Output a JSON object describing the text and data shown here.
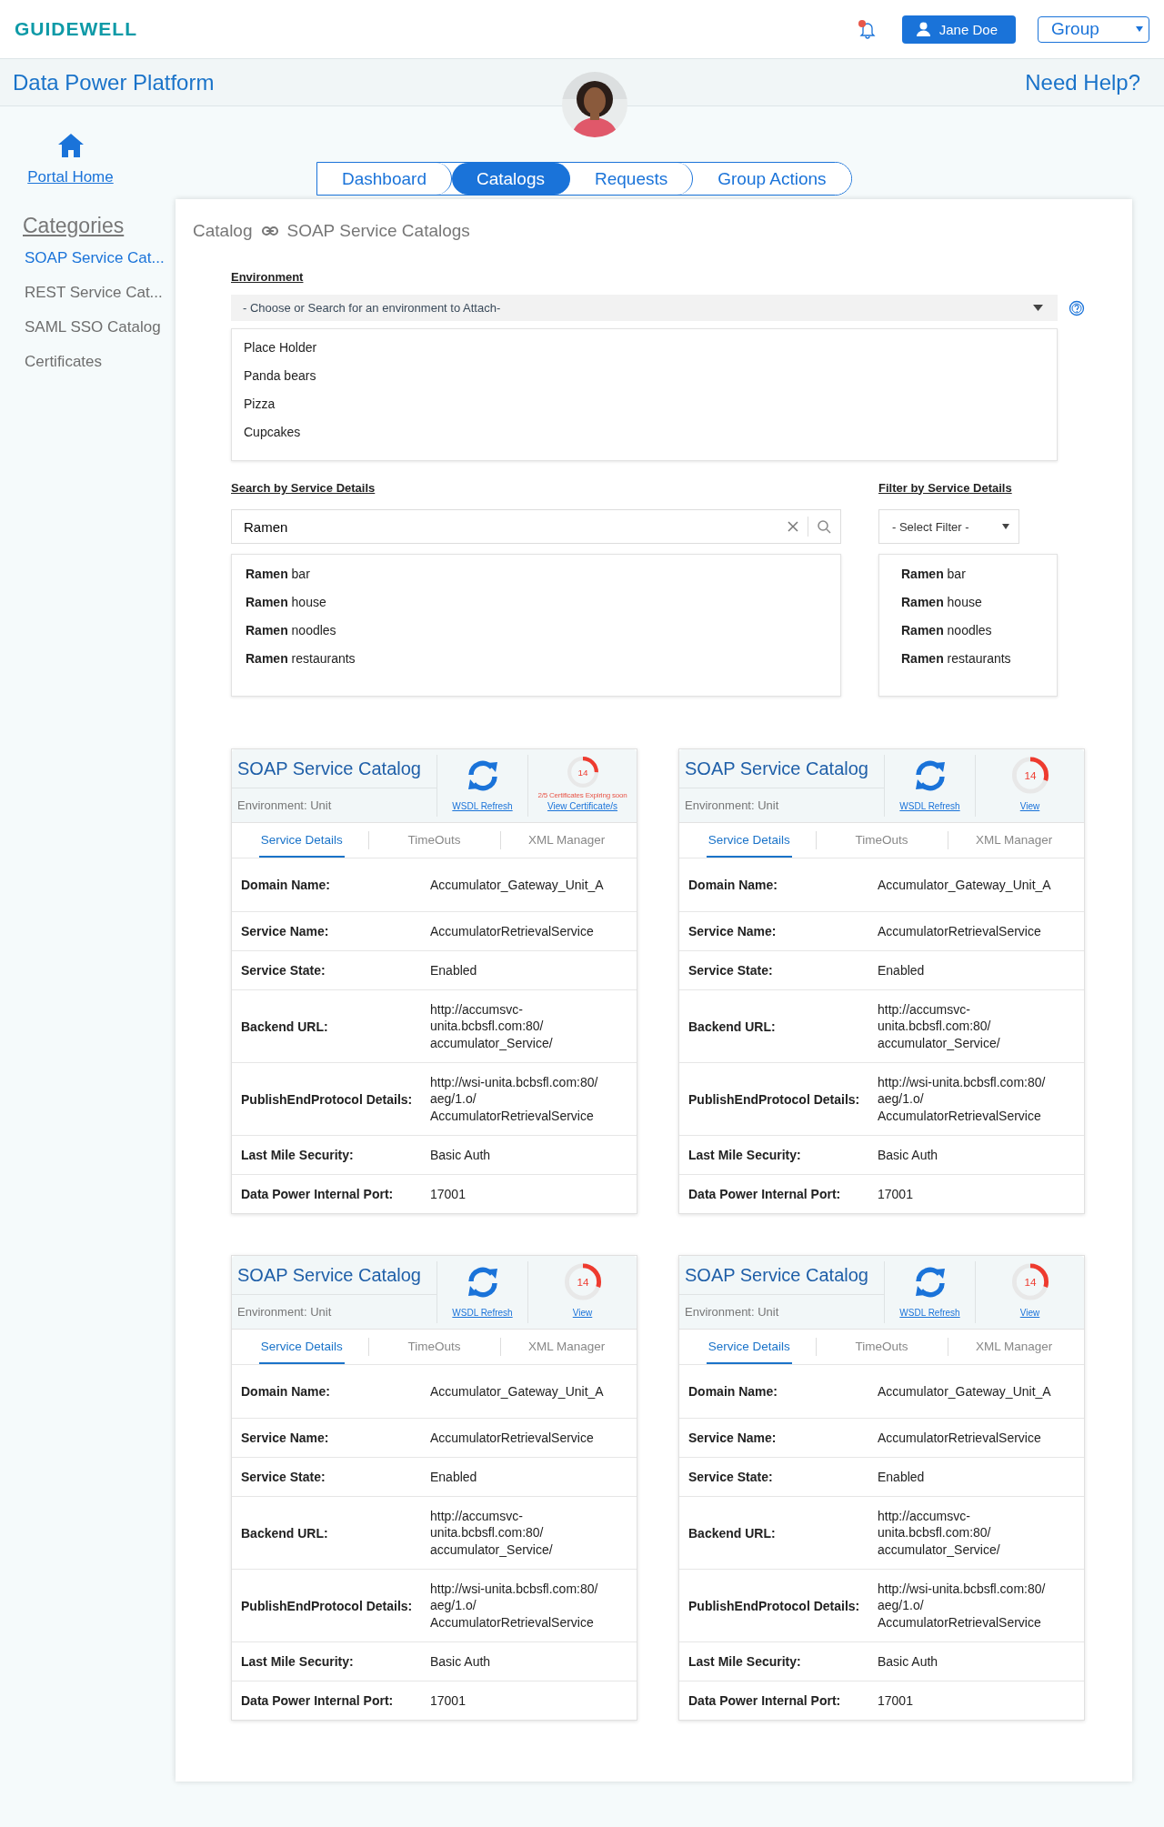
{
  "header": {
    "logo": "GUIDEWELL",
    "has_notification": true,
    "user": "Jane Doe",
    "group": "Group"
  },
  "subheader": {
    "title": "Data Power Platform",
    "help": "Need Help?"
  },
  "sidebar": {
    "home": "Portal Home",
    "heading": "Categories",
    "items": [
      {
        "label": "SOAP Service Cat...",
        "selected": true
      },
      {
        "label": "REST Service Cat...",
        "selected": false
      },
      {
        "label": "SAML SSO Catalog",
        "selected": false
      },
      {
        "label": "Certificates",
        "selected": false
      }
    ]
  },
  "tabs": [
    {
      "label": "Dashboard",
      "selected": false
    },
    {
      "label": "Catalogs",
      "selected": true
    },
    {
      "label": "Requests",
      "selected": false
    },
    {
      "label": "Group Actions",
      "selected": false
    }
  ],
  "breadcrumb": [
    "Catalog",
    "SOAP Service Catalogs"
  ],
  "environment": {
    "label": "Environment",
    "placeholder": "- Choose or Search for an environment to Attach-",
    "options": [
      "Place Holder",
      "Panda bears",
      "Pizza",
      "Cupcakes"
    ]
  },
  "search": {
    "label": "Search by Service Details",
    "value": "Ramen",
    "suggestions": [
      "**Ramen** bar",
      "**Ramen** house",
      "**Ramen** noodles",
      "**Ramen** restaurants"
    ]
  },
  "filter": {
    "label": "Filter by Service Details",
    "placeholder": "- Select Filter -",
    "suggestions": [
      "**Ramen** bar",
      "**Ramen** house",
      "**Ramen** noodles",
      "**Ramen** restaurants"
    ]
  },
  "cards": [
    {
      "title": "SOAP Service Catalog",
      "environment": "Environment: Unit",
      "refresh": "WSDL Refresh",
      "cert_count": "14",
      "level": 0.25,
      "warning": "2/5 Certificates Expiring soon",
      "link": "View Certificate/s",
      "tabs": [
        {
          "label": "Service Details",
          "selected": true
        },
        {
          "label": "TimeOuts",
          "selected": false
        },
        {
          "label": "XML Manager",
          "selected": false
        }
      ],
      "rows": [
        {
          "label": "Domain Name:",
          "value": [
            "Accumulator_Gateway_Unit_A"
          ]
        },
        {
          "label": "Service Name:",
          "value": [
            "AccumulatorRetrievalService"
          ]
        },
        {
          "label": "Service State:",
          "value": [
            "Enabled"
          ]
        },
        {
          "label": "Backend URL:",
          "value": [
            "http://accumsvc-",
            "unita.bcbsfl.com:80/",
            "accumulator_Service/"
          ]
        },
        {
          "label": "PublishEndProtocol Details:",
          "value": [
            "http://wsi-unita.bcbsfl.com:80/",
            "aeg/1.o/",
            "AccumulatorRetrievalService"
          ]
        },
        {
          "label": "Last Mile Security:",
          "value": [
            "Basic Auth"
          ]
        },
        {
          "label": "Data Power Internal Port:",
          "value": [
            "17001"
          ]
        }
      ]
    },
    {
      "title": "SOAP Service Catalog",
      "environment": "Environment: Unit",
      "refresh": "WSDL Refresh",
      "cert_count": "14",
      "level": 0.3,
      "link": "View",
      "tabs": [
        {
          "label": "Service Details",
          "selected": true
        },
        {
          "label": "TimeOuts",
          "selected": false
        },
        {
          "label": "XML Manager",
          "selected": false
        }
      ],
      "rows": [
        {
          "label": "Domain Name:",
          "value": [
            "Accumulator_Gateway_Unit_A"
          ]
        },
        {
          "label": "Service Name:",
          "value": [
            "AccumulatorRetrievalService"
          ]
        },
        {
          "label": "Service State:",
          "value": [
            "Enabled"
          ]
        },
        {
          "label": "Backend URL:",
          "value": [
            "http://accumsvc-",
            "unita.bcbsfl.com:80/",
            "accumulator_Service/"
          ]
        },
        {
          "label": "PublishEndProtocol Details:",
          "value": [
            "http://wsi-unita.bcbsfl.com:80/",
            "aeg/1.o/",
            "AccumulatorRetrievalService"
          ]
        },
        {
          "label": "Last Mile Security:",
          "value": [
            "Basic Auth"
          ]
        },
        {
          "label": "Data Power Internal Port:",
          "value": [
            "17001"
          ]
        }
      ]
    },
    {
      "title": "SOAP Service Catalog",
      "environment": "Environment: Unit",
      "refresh": "WSDL Refresh",
      "cert_count": "14",
      "level": 0.3,
      "link": "View",
      "tabs": [
        {
          "label": "Service Details",
          "selected": true
        },
        {
          "label": "TimeOuts",
          "selected": false
        },
        {
          "label": "XML Manager",
          "selected": false
        }
      ],
      "rows": [
        {
          "label": "Domain Name:",
          "value": [
            "Accumulator_Gateway_Unit_A"
          ]
        },
        {
          "label": "Service Name:",
          "value": [
            "AccumulatorRetrievalService"
          ]
        },
        {
          "label": "Service State:",
          "value": [
            "Enabled"
          ]
        },
        {
          "label": "Backend URL:",
          "value": [
            "http://accumsvc-",
            "unita.bcbsfl.com:80/",
            "accumulator_Service/"
          ]
        },
        {
          "label": "PublishEndProtocol Details:",
          "value": [
            "http://wsi-unita.bcbsfl.com:80/",
            "aeg/1.o/",
            "AccumulatorRetrievalService"
          ]
        },
        {
          "label": "Last Mile Security:",
          "value": [
            "Basic Auth"
          ]
        },
        {
          "label": "Data Power Internal Port:",
          "value": [
            "17001"
          ]
        }
      ]
    },
    {
      "title": "SOAP Service Catalog",
      "environment": "Environment: Unit",
      "refresh": "WSDL Refresh",
      "cert_count": "14",
      "level": 0.3,
      "link": "View",
      "tabs": [
        {
          "label": "Service Details",
          "selected": true
        },
        {
          "label": "TimeOuts",
          "selected": false
        },
        {
          "label": "XML Manager",
          "selected": false
        }
      ],
      "rows": [
        {
          "label": "Domain Name:",
          "value": [
            "Accumulator_Gateway_Unit_A"
          ]
        },
        {
          "label": "Service Name:",
          "value": [
            "AccumulatorRetrievalService"
          ]
        },
        {
          "label": "Service State:",
          "value": [
            "Enabled"
          ]
        },
        {
          "label": "Backend URL:",
          "value": [
            "http://accumsvc-",
            "unita.bcbsfl.com:80/",
            "accumulator_Service/"
          ]
        },
        {
          "label": "PublishEndProtocol Details:",
          "value": [
            "http://wsi-unita.bcbsfl.com:80/",
            "aeg/1.o/",
            "AccumulatorRetrievalService"
          ]
        },
        {
          "label": "Last Mile Security:",
          "value": [
            "Basic Auth"
          ]
        },
        {
          "label": "Data Power Internal Port:",
          "value": [
            "17001"
          ]
        }
      ]
    }
  ]
}
